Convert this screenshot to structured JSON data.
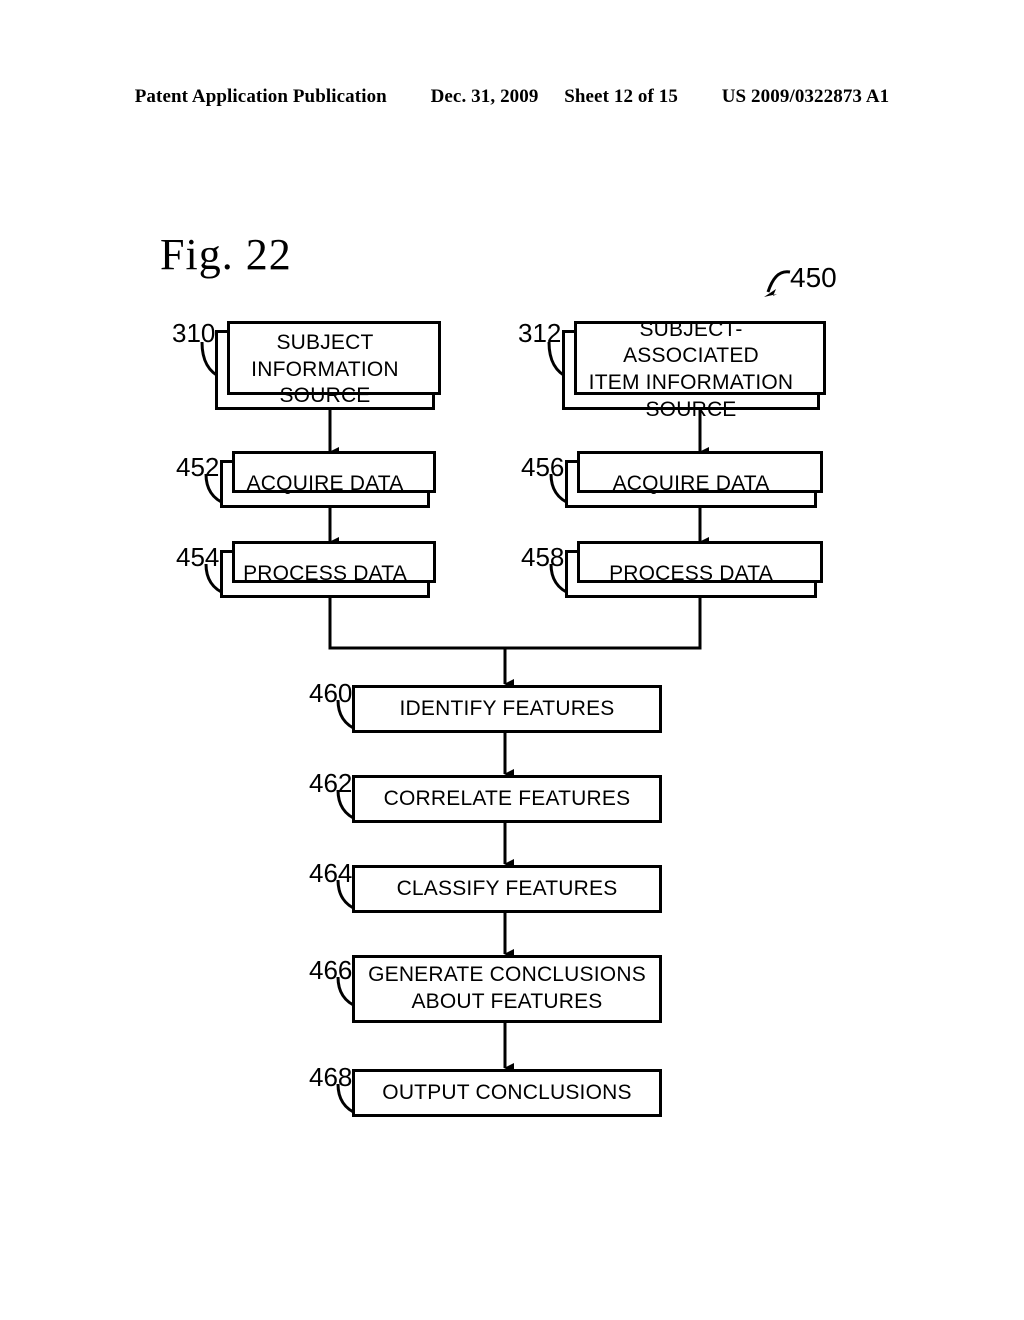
{
  "header": {
    "publication": "Patent Application Publication",
    "date": "Dec. 31, 2009",
    "sheet": "Sheet 12 of 15",
    "patent_number": "US 2009/0322873 A1"
  },
  "figure": {
    "title": "Fig. 22",
    "system_ref": "450"
  },
  "nodes": [
    {
      "ref": "310",
      "label": "SUBJECT\nINFORMATION\nSOURCE",
      "stacked": true
    },
    {
      "ref": "312",
      "label": "SUBJECT-ASSOCIATED\nITEM INFORMATION\nSOURCE",
      "stacked": true
    },
    {
      "ref": "452",
      "label": "ACQUIRE DATA",
      "stacked": true
    },
    {
      "ref": "456",
      "label": "ACQUIRE DATA",
      "stacked": true
    },
    {
      "ref": "454",
      "label": "PROCESS DATA",
      "stacked": true
    },
    {
      "ref": "458",
      "label": "PROCESS DATA",
      "stacked": true
    },
    {
      "ref": "460",
      "label": "IDENTIFY FEATURES",
      "stacked": false
    },
    {
      "ref": "462",
      "label": "CORRELATE FEATURES",
      "stacked": false
    },
    {
      "ref": "464",
      "label": "CLASSIFY FEATURES",
      "stacked": false
    },
    {
      "ref": "466",
      "label": "GENERATE CONCLUSIONS\nABOUT FEATURES",
      "stacked": false
    },
    {
      "ref": "468",
      "label": "OUTPUT CONCLUSIONS",
      "stacked": false
    }
  ],
  "colors": {
    "ink": "#000000",
    "paper": "#ffffff"
  }
}
